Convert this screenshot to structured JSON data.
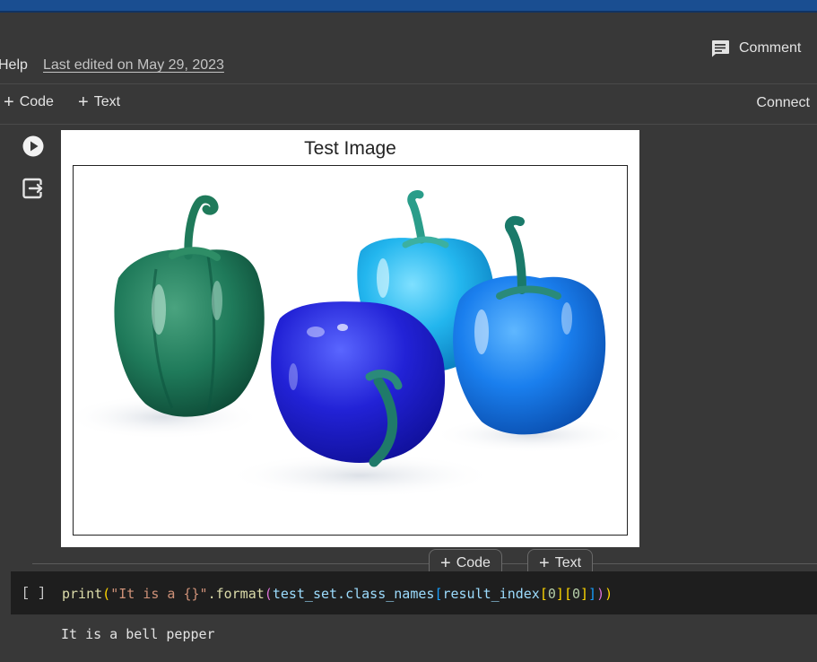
{
  "header": {
    "menu_help": "Help",
    "last_edited": "Last edited on May 29, 2023",
    "comment_label": "Comment"
  },
  "toolbar": {
    "add_code": "Code",
    "add_text": "Text",
    "connect": "Connect"
  },
  "cell_output": {
    "figure_title": "Test Image",
    "image_description_icon": "bell-peppers-image"
  },
  "insert_bar": {
    "add_code": "Code",
    "add_text": "Text"
  },
  "code_cell": {
    "bracket": "[ ]",
    "tokens": {
      "fn": "print",
      "open": "(",
      "str": "\"It is a {}\"",
      "dot_format": ".format",
      "open2": "(",
      "var": "test_set.class_names",
      "b_open": "[",
      "idx": "result_index",
      "i1": "[",
      "n1": "0",
      "i1c": "]",
      "i2": "[",
      "n2": "0",
      "i2c": "]",
      "b_close": "]",
      "close2": ")",
      "close": ")"
    },
    "output": "It is a bell pepper"
  },
  "colors": {
    "background": "#383838",
    "code_bg": "#1e1e1e",
    "top_accent": "#1a4e91"
  }
}
